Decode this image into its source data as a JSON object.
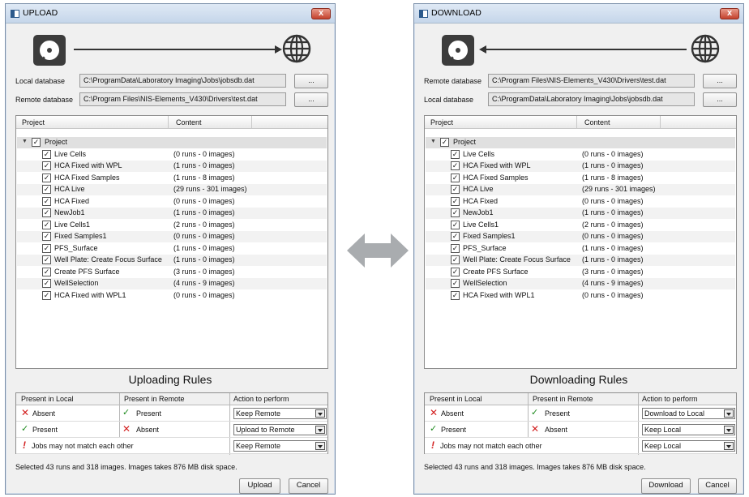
{
  "upload": {
    "title": "UPLOAD",
    "close_label": "x",
    "row1": {
      "label": "Local database",
      "path": "C:\\ProgramData\\Laboratory Imaging\\Jobs\\jobsdb.dat",
      "browse_label": "..."
    },
    "row2": {
      "label": "Remote database",
      "path": "C:\\Program Files\\NIS-Elements_V430\\Drivers\\test.dat",
      "browse_label": "..."
    },
    "columns": {
      "project": "Project",
      "content": "Content"
    },
    "root_label": "Project",
    "projects": [
      {
        "name": "Live Cells",
        "content": "(0 runs - 0 images)"
      },
      {
        "name": "HCA Fixed with WPL",
        "content": "(1 runs - 0 images)"
      },
      {
        "name": "HCA Fixed Samples",
        "content": "(1 runs - 8 images)"
      },
      {
        "name": "HCA Live",
        "content": "(29 runs - 301 images)"
      },
      {
        "name": "HCA Fixed",
        "content": "(0 runs - 0 images)"
      },
      {
        "name": "NewJob1",
        "content": "(1 runs - 0 images)"
      },
      {
        "name": "Live Cells1",
        "content": "(2 runs - 0 images)"
      },
      {
        "name": "Fixed Samples1",
        "content": "(0 runs - 0 images)"
      },
      {
        "name": "PFS_Surface",
        "content": "(1 runs - 0 images)"
      },
      {
        "name": "Well Plate: Create Focus Surface",
        "content": "(1 runs - 0 images)"
      },
      {
        "name": "Create PFS Surface",
        "content": "(3 runs - 0 images)"
      },
      {
        "name": "WellSelection",
        "content": "(4 runs - 9 images)"
      },
      {
        "name": "HCA Fixed with WPL1",
        "content": "(0 runs - 0 images)"
      }
    ],
    "rules_title": "Uploading Rules",
    "rules_headers": {
      "local": "Present in Local",
      "remote": "Present in Remote",
      "action": "Action to perform"
    },
    "rules": [
      {
        "local": "Absent",
        "remote": "Present",
        "action": "Keep Remote"
      },
      {
        "local": "Present",
        "remote": "Absent",
        "action": "Upload to Remote"
      },
      {
        "note": "Jobs may not match each other",
        "action": "Keep Remote"
      }
    ],
    "status": "Selected 43 runs and 318 images. Images takes 876 MB disk space.",
    "primary_button": "Upload",
    "cancel_button": "Cancel"
  },
  "download": {
    "title": "DOWNLOAD",
    "close_label": "x",
    "row1": {
      "label": "Remote database",
      "path": "C:\\Program Files\\NIS-Elements_V430\\Drivers\\test.dat",
      "browse_label": "..."
    },
    "row2": {
      "label": "Local database",
      "path": "C:\\ProgramData\\Laboratory Imaging\\Jobs\\jobsdb.dat",
      "browse_label": "..."
    },
    "columns": {
      "project": "Project",
      "content": "Content"
    },
    "root_label": "Project",
    "projects": [
      {
        "name": "Live Cells",
        "content": "(0 runs - 0 images)"
      },
      {
        "name": "HCA Fixed with WPL",
        "content": "(1 runs - 0 images)"
      },
      {
        "name": "HCA Fixed Samples",
        "content": "(1 runs - 8 images)"
      },
      {
        "name": "HCA Live",
        "content": "(29 runs - 301 images)"
      },
      {
        "name": "HCA Fixed",
        "content": "(0 runs - 0 images)"
      },
      {
        "name": "NewJob1",
        "content": "(1 runs - 0 images)"
      },
      {
        "name": "Live Cells1",
        "content": "(2 runs - 0 images)"
      },
      {
        "name": "Fixed Samples1",
        "content": "(0 runs - 0 images)"
      },
      {
        "name": "PFS_Surface",
        "content": "(1 runs - 0 images)"
      },
      {
        "name": "Well Plate: Create Focus Surface",
        "content": "(1 runs - 0 images)"
      },
      {
        "name": "Create PFS Surface",
        "content": "(3 runs - 0 images)"
      },
      {
        "name": "WellSelection",
        "content": "(4 runs - 9 images)"
      },
      {
        "name": "HCA Fixed with WPL1",
        "content": "(0 runs - 0 images)"
      }
    ],
    "rules_title": "Downloading Rules",
    "rules_headers": {
      "local": "Present in Local",
      "remote": "Present in Remote",
      "action": "Action to perform"
    },
    "rules": [
      {
        "local": "Absent",
        "remote": "Present",
        "action": "Download to Local"
      },
      {
        "local": "Present",
        "remote": "Absent",
        "action": "Keep Local"
      },
      {
        "note": "Jobs may not match each other",
        "action": "Keep Local"
      }
    ],
    "status": "Selected 43 runs and 318 images. Images takes 876 MB disk space.",
    "primary_button": "Download",
    "cancel_button": "Cancel"
  },
  "icons": {
    "local": "hard-disk-icon",
    "remote": "globe-icon",
    "between": "double-arrow-icon"
  },
  "colors": {
    "absent_mark": "#d32020",
    "present_mark": "#1d8a1d",
    "arrow_gray": "#a9acaf"
  }
}
